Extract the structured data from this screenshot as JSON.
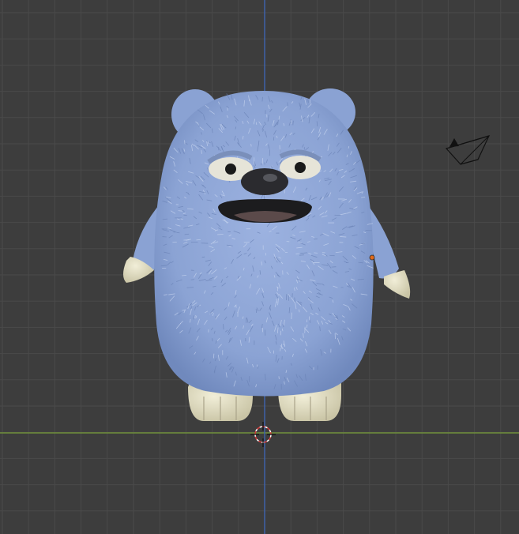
{
  "viewport": {
    "background_color": "#3d3d3d",
    "grid_color": "#4a4a4a",
    "x_axis_color": "#6f8f3a",
    "z_axis_color": "#3f62a8"
  },
  "scene": {
    "character": {
      "name": "blue-furry-monster",
      "fur_color": "#8ea6d6",
      "fur_shadow_color": "#6f87bb",
      "claw_color": "#e3dfc3"
    },
    "camera_icon": "camera-icon",
    "cursor_icon": "3d-cursor-icon",
    "origin_marker_color": "#e06a1c"
  }
}
